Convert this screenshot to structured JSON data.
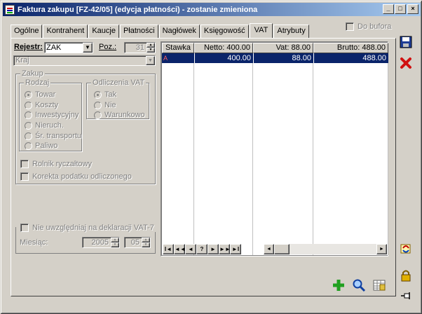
{
  "window": {
    "title": "Faktura zakupu [FZ-42/05] (edycja płatności) - zostanie zmieniona",
    "minimize": "_",
    "maximize": "□",
    "close": "×"
  },
  "tabs": [
    {
      "label": "Ogólne",
      "active": false
    },
    {
      "label": "Kontrahent",
      "active": false
    },
    {
      "label": "Kaucje",
      "active": false
    },
    {
      "label": "Płatności",
      "active": false
    },
    {
      "label": "Nagłówek",
      "active": false
    },
    {
      "label": "Księgowość",
      "active": false
    },
    {
      "label": "VAT",
      "active": true
    },
    {
      "label": "Atrybuty",
      "active": false
    }
  ],
  "do_bufora": {
    "label": "Do bufora",
    "checked": false
  },
  "rejestr": {
    "label": "Rejestr:",
    "value": "ZAK"
  },
  "poz": {
    "label": "Poz.:",
    "value": "31"
  },
  "kraj": {
    "value": "Kraj"
  },
  "zakup": {
    "legend": "Zakup",
    "rodzaj": {
      "legend": "Rodzaj",
      "options": [
        {
          "label": "Towar",
          "selected": true
        },
        {
          "label": "Koszty",
          "selected": false
        },
        {
          "label": "Inwestycyjny",
          "selected": false
        },
        {
          "label": "Nieruch.",
          "selected": false
        },
        {
          "label": "Śr. transportu",
          "selected": false
        },
        {
          "label": "Paliwo",
          "selected": false
        }
      ]
    },
    "odliczenia": {
      "legend": "Odliczenia VAT",
      "options": [
        {
          "label": "Tak",
          "selected": true
        },
        {
          "label": "Nie",
          "selected": false
        },
        {
          "label": "Warunkowo",
          "selected": false
        }
      ]
    },
    "rolnik": "Rolnik ryczałtowy",
    "korekta": "Korekta podatku odliczonego"
  },
  "deklaracja": {
    "label": "Nie uwzględniaj na deklaracji VAT-7",
    "miesiac_label": "Miesiąc:",
    "rok": "2005",
    "miesiac": "05"
  },
  "vat_table": {
    "headers": [
      "Stawka",
      "Netto: 400.00",
      "Vat: 88.00",
      "Brutto: 488.00"
    ],
    "rows": [
      {
        "stawka": "A",
        "netto": "400.00",
        "vat": "88.00",
        "brutto": "488.00"
      }
    ]
  },
  "navbar": [
    "I◄",
    "◄◄",
    "◄",
    "?",
    "►",
    "►►",
    "►I"
  ],
  "colors": {
    "title_start": "#0a246a",
    "title_end": "#a6caf0",
    "selection": "#0a246a",
    "face": "#d4d0c8"
  },
  "icons": {
    "save": "floppy-disk-icon",
    "cancel": "red-x-icon",
    "refresh": "currency-refresh-icon",
    "lock": "padlock-icon",
    "pin": "pin-icon",
    "add": "green-plus-icon",
    "search": "magnifier-icon",
    "grid": "table-icon"
  }
}
